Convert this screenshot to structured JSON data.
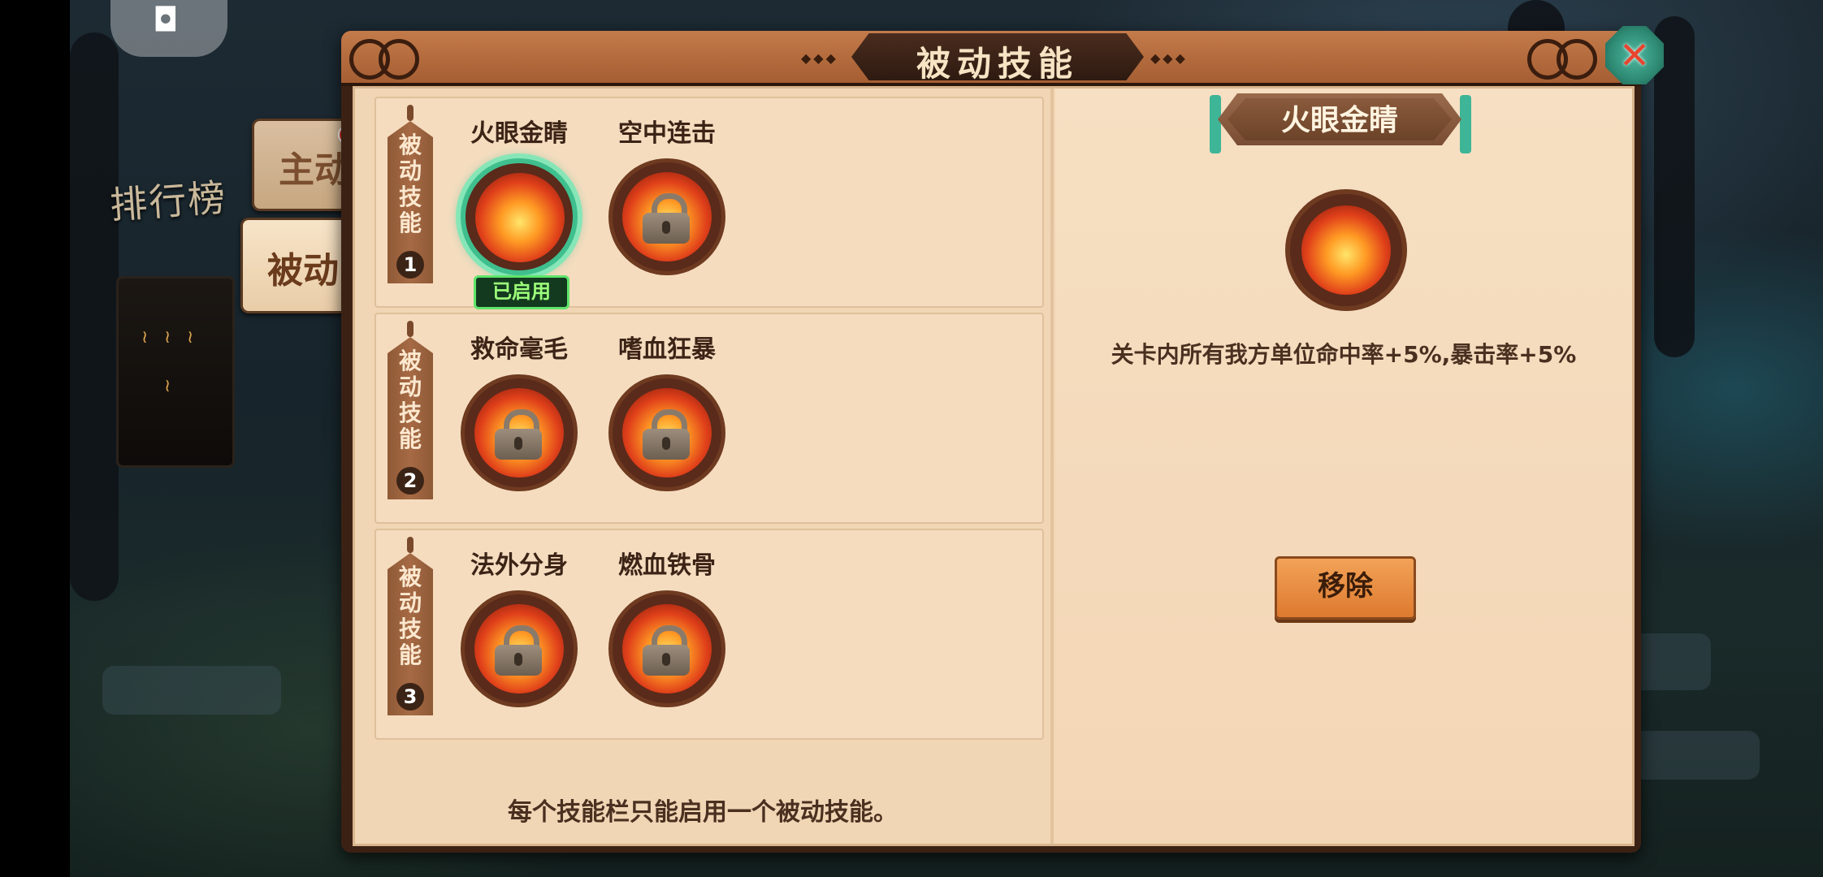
{
  "status_bar": {
    "icon": "back-icon",
    "glyph": "◘"
  },
  "background": {
    "ranking_label": "排行榜",
    "pillar_glyphs": [
      "≀",
      "≀",
      "≀",
      "≀"
    ]
  },
  "side_tabs": [
    {
      "label": "主动",
      "active": false,
      "has_notification": true
    },
    {
      "label": "被动",
      "active": true,
      "has_notification": false
    }
  ],
  "panel": {
    "title": "被动技能",
    "close_icon": "close-icon",
    "close_glyph": "✕"
  },
  "slots": [
    {
      "tag": "被动技能",
      "number": "1",
      "skills": [
        {
          "name": "火眼金睛",
          "locked": false,
          "selected": true,
          "badge": "已启用"
        },
        {
          "name": "空中连击",
          "locked": true,
          "selected": false
        }
      ]
    },
    {
      "tag": "被动技能",
      "number": "2",
      "skills": [
        {
          "name": "救命毫毛",
          "locked": true,
          "selected": false
        },
        {
          "name": "嗜血狂暴",
          "locked": true,
          "selected": false
        }
      ]
    },
    {
      "tag": "被动技能",
      "number": "3",
      "skills": [
        {
          "name": "法外分身",
          "locked": true,
          "selected": false
        },
        {
          "name": "燃血铁骨",
          "locked": true,
          "selected": false
        }
      ]
    }
  ],
  "footer_hint": "每个技能栏只能启用一个被动技能。",
  "detail": {
    "title": "火眼金睛",
    "description": "关卡内所有我方单位命中率+5%,暴击率+5%",
    "remove_button": "移除"
  },
  "colors": {
    "panel_header": "#b8693b",
    "panel_body": "#f1d6b5",
    "selected_ring": "#3fbf8d",
    "enabled_badge": "#5fe46a",
    "remove_button": "#ea8e42"
  }
}
